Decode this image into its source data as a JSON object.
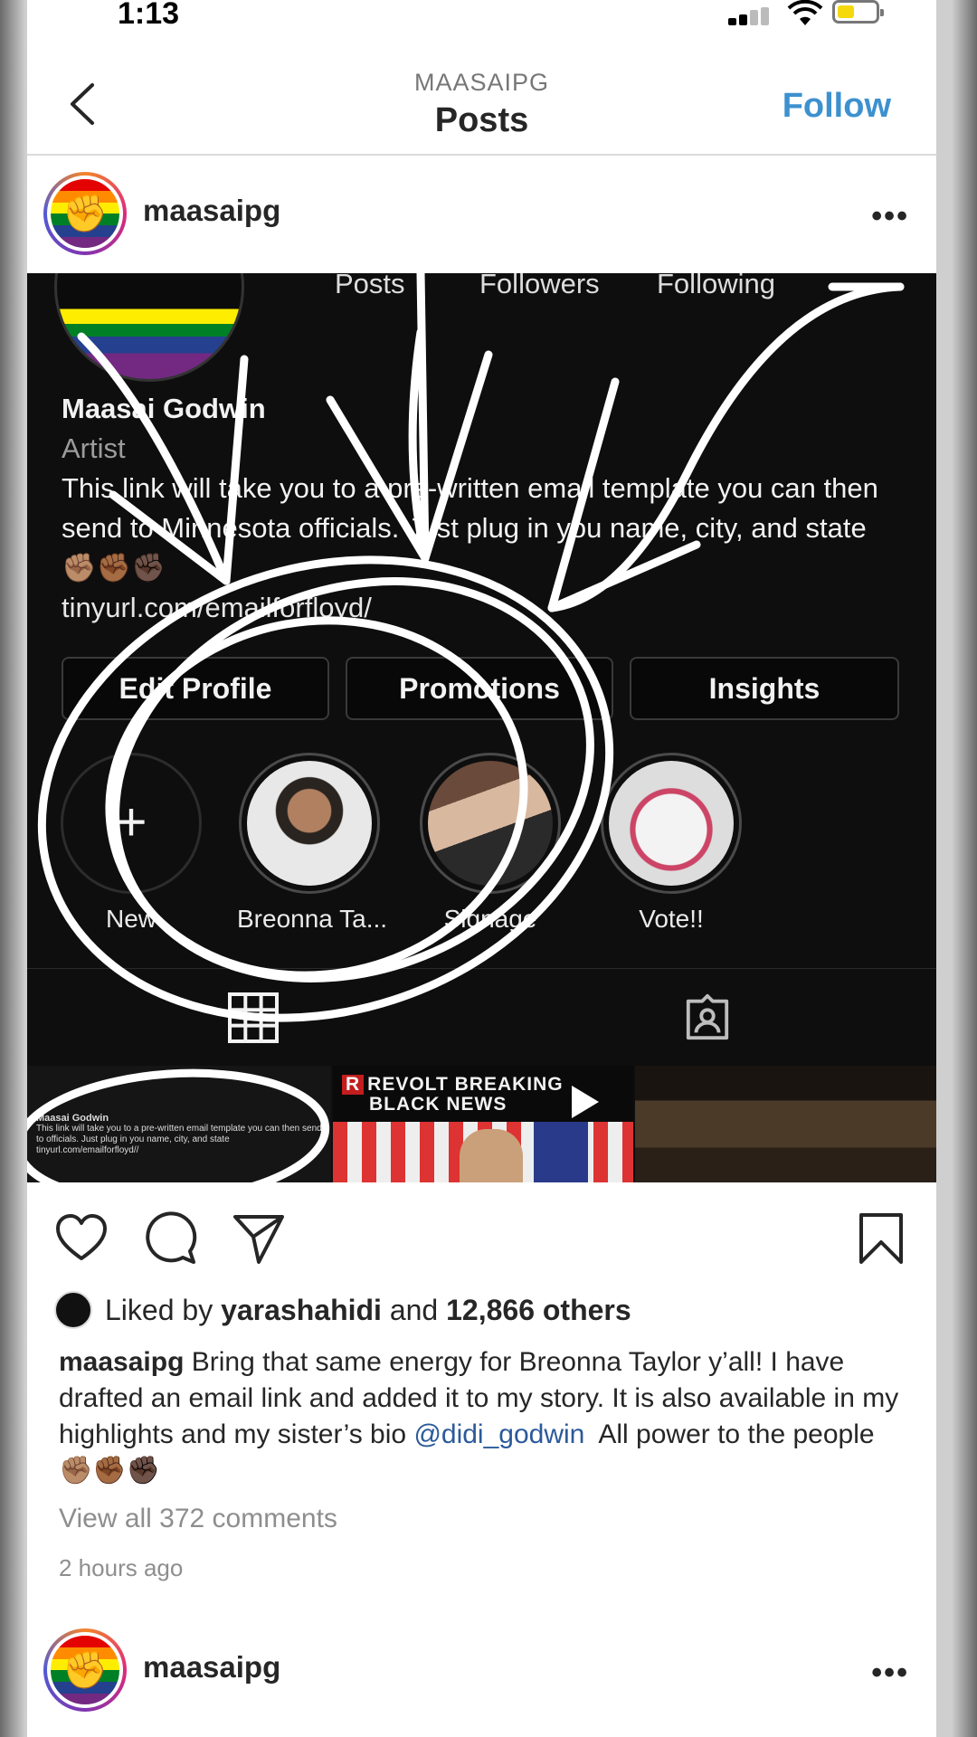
{
  "status_bar": {
    "time": "1:13",
    "icons": [
      "cellular-signal-icon",
      "wifi-icon",
      "battery-icon"
    ],
    "battery_color": "#f5d90a"
  },
  "nav": {
    "back_icon": "chevron-left-icon",
    "subtitle": "MAASAIPG",
    "title": "Posts",
    "follow_label": "Follow",
    "follow_color": "#3d91cf"
  },
  "post": {
    "username": "maasaipg",
    "more_icon": "more-horizontal-icon",
    "image": {
      "stat_labels": [
        "Posts",
        "Followers",
        "Following"
      ],
      "profile_name": "Maasai Godwin",
      "category": "Artist",
      "bio": "This link will take you to a pre-written email template you can then send to Minnesota officials. Just plug in you name, city, and state ✊🏽✊🏾✊🏿",
      "link": "tinyurl.com/emailforfloyd/",
      "buttons": [
        "Edit Profile",
        "Promotions",
        "Insights"
      ],
      "highlights": [
        {
          "label": "New"
        },
        {
          "label": "Breonna Ta..."
        },
        {
          "label": "Signage"
        },
        {
          "label": "Vote!!"
        }
      ],
      "thumb1_name": "Maasai Godwin",
      "thumb1_text": "This link will take you to a pre-written email template you can then send to officials. Just plug in you name, city, and state",
      "thumb1_link": "tinyurl.com/emailforfloyd//",
      "thumb2_title_line1": "REVOLT BREAKING",
      "thumb2_title_line2": "BLACK NEWS",
      "thumb2_logo": "R"
    },
    "actions": [
      "heart-icon",
      "comment-icon",
      "share-icon",
      "bookmark-icon"
    ],
    "liked_by_prefix": "Liked by",
    "liked_by_user": "yarashahidi",
    "liked_by_and": "and",
    "liked_by_count": "12,866 others",
    "caption_user": "maasaipg",
    "caption_text": "Bring that same energy for Breonna Taylor y’all! I have drafted an email link and added it to my story. It is also available in my highlights and my sister’s bio",
    "caption_mention": "@didi_godwin",
    "caption_end": "All power to the people ✊🏽✊🏾✊🏿",
    "view_comments": "View all 372 comments",
    "time_ago": "2 hours ago"
  },
  "next_post": {
    "username": "maasaipg"
  }
}
